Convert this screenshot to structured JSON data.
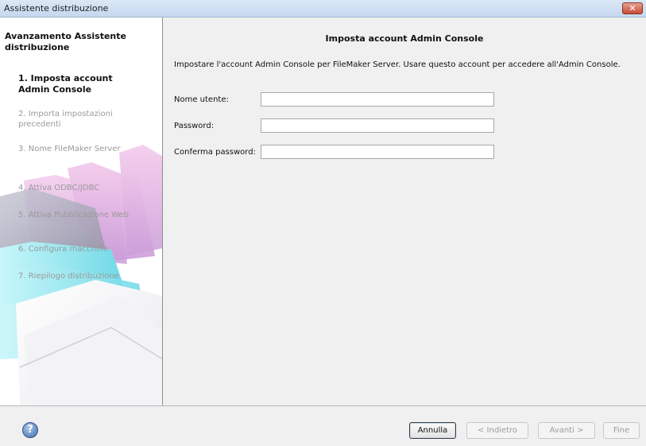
{
  "window": {
    "title": "Assistente distribuzione"
  },
  "sidebar": {
    "heading": "Avanzamento Assistente distribuzione",
    "steps": [
      {
        "label": "1. Imposta account Admin Console",
        "active": true
      },
      {
        "label": "2. Importa impostazioni precedenti",
        "active": false
      },
      {
        "label": "3. Nome FileMaker Server",
        "active": false
      },
      {
        "label": "4. Attiva ODBC/JDBC",
        "active": false
      },
      {
        "label": "5. Attiva Pubblicazione Web",
        "active": false
      },
      {
        "label": "6. Configura macchine",
        "active": false
      },
      {
        "label": "7. Riepilogo distribuzione",
        "active": false
      }
    ]
  },
  "main": {
    "title": "Imposta account Admin Console",
    "description": "Impostare l'account Admin Console per FileMaker Server. Usare questo account per accedere all'Admin Console.",
    "fields": {
      "username": {
        "label": "Nome utente:",
        "value": ""
      },
      "password": {
        "label": "Password:",
        "value": ""
      },
      "confirm": {
        "label": "Conferma password:",
        "value": ""
      }
    }
  },
  "footer": {
    "cancel": "Annulla",
    "back": "< Indietro",
    "next": "Avanti >",
    "finish": "Fine"
  },
  "icons": {
    "close": "close-icon",
    "help": "help-icon"
  },
  "colors": {
    "titlebar": "#c5d8ee",
    "close_button": "#c84a35",
    "accent_magenta": "#e8a2d6",
    "accent_cyan": "#7fe3ee"
  }
}
